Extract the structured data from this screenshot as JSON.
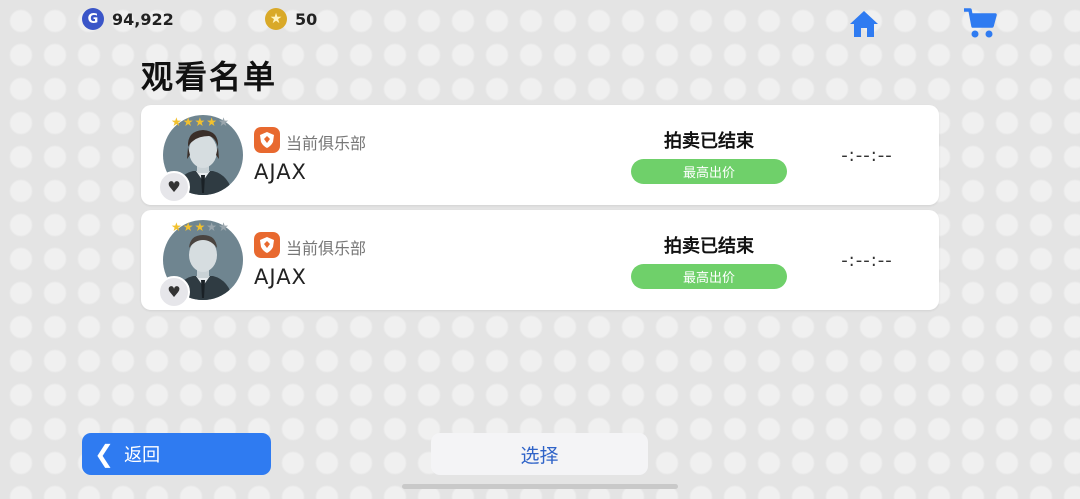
{
  "currency": {
    "gp": {
      "icon": "gp-coin-icon",
      "glyph": "G",
      "value": "94,922"
    },
    "coins": {
      "icon": "star-coin-icon",
      "glyph": "★",
      "value": "50"
    }
  },
  "nav": {
    "home_icon": "home-icon",
    "cart_icon": "cart-icon",
    "accent": "#2f7bf1"
  },
  "page_title": "观看名单",
  "players": [
    {
      "stars": 4,
      "club_label": "当前俱乐部",
      "club_name": "AJAX",
      "status": "拍卖已结束",
      "bid_label": "最高出价",
      "timer": "-:--:--"
    },
    {
      "stars": 3,
      "club_label": "当前俱乐部",
      "club_name": "AJAX",
      "status": "拍卖已结束",
      "bid_label": "最高出价",
      "timer": "-:--:--"
    }
  ],
  "footer": {
    "back_label": "返回",
    "select_label": "选择"
  },
  "colors": {
    "bid_badge": "#6fd06a",
    "club_icon": "#e8692f",
    "back_button": "#2f7bf1"
  }
}
